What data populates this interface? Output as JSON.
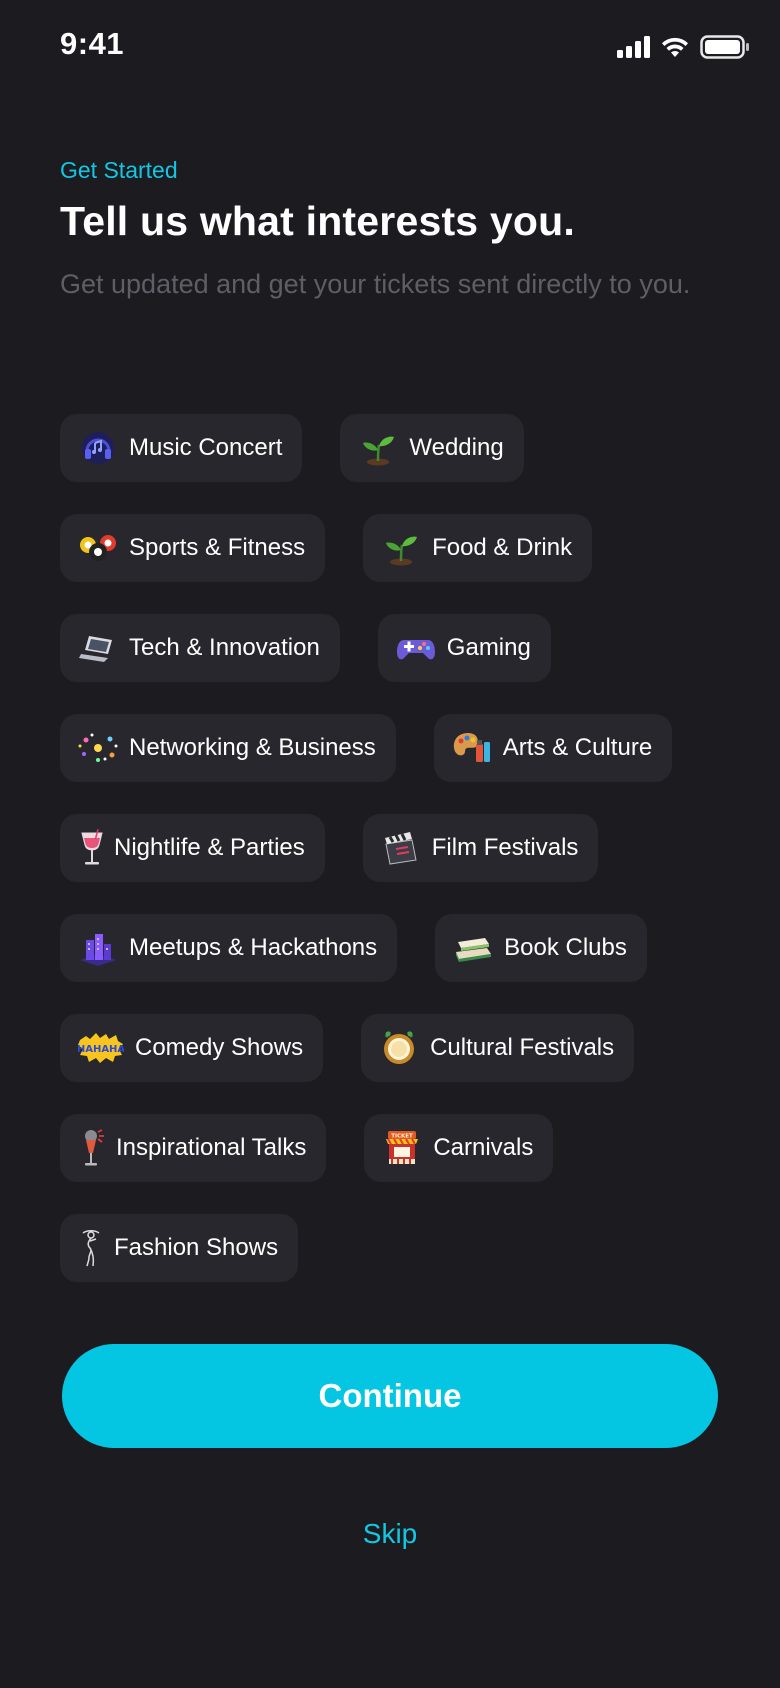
{
  "status_bar": {
    "time": "9:41",
    "icons": [
      "cellular-signal-icon",
      "wifi-icon",
      "battery-icon"
    ]
  },
  "header": {
    "eyebrow": "Get Started",
    "title": "Tell us what interests you.",
    "subtitle": "Get updated and get your tickets sent directly to you."
  },
  "interests": [
    [
      {
        "label": "Music Concert",
        "icon": "headphones-icon"
      },
      {
        "label": "Wedding",
        "icon": "seedling-icon"
      }
    ],
    [
      {
        "label": "Sports & Fitness",
        "icon": "billiard-balls-icon"
      },
      {
        "label": "Food & Drink",
        "icon": "seedling-icon"
      }
    ],
    [
      {
        "label": "Tech & Innovation",
        "icon": "laptop-icon"
      },
      {
        "label": "Gaming",
        "icon": "game-controller-icon"
      }
    ],
    [
      {
        "label": "Networking & Business",
        "icon": "sparkles-network-icon"
      },
      {
        "label": "Arts & Culture",
        "icon": "palette-icon"
      }
    ],
    [
      {
        "label": "Nightlife & Parties",
        "icon": "cocktail-glass-icon"
      },
      {
        "label": "Film Festivals",
        "icon": "clapperboard-icon"
      }
    ],
    [
      {
        "label": "Meetups & Hackathons",
        "icon": "city-buildings-icon"
      },
      {
        "label": "Book Clubs",
        "icon": "books-icon"
      }
    ],
    [
      {
        "label": "Comedy Shows",
        "icon": "hahaha-icon"
      },
      {
        "label": "Cultural Festivals",
        "icon": "festival-drum-icon"
      }
    ],
    [
      {
        "label": "Inspirational Talks",
        "icon": "microphone-icon"
      },
      {
        "label": "Carnivals",
        "icon": "ticket-booth-icon"
      }
    ],
    [
      {
        "label": "Fashion Shows",
        "icon": "fashion-figure-icon"
      }
    ]
  ],
  "actions": {
    "continue_label": "Continue",
    "skip_label": "Skip"
  },
  "colors": {
    "background": "#1c1b20",
    "chip_background": "#28272d",
    "accent": "#05c6e2",
    "subtitle": "#5f5e66"
  }
}
